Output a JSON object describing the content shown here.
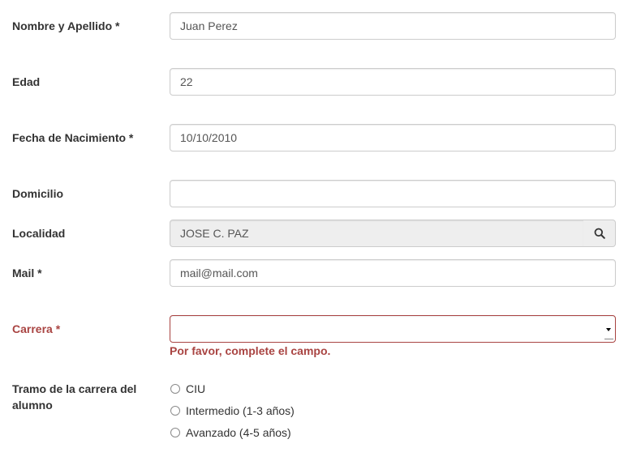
{
  "form": {
    "nombre": {
      "label": "Nombre y Apellido *",
      "value": "Juan Perez"
    },
    "edad": {
      "label": "Edad",
      "value": "22"
    },
    "fecha": {
      "label": "Fecha de Nacimiento *",
      "value": "10/10/2010"
    },
    "domicilio": {
      "label": "Domicilio",
      "value": ""
    },
    "localidad": {
      "label": "Localidad",
      "value": "JOSE C. PAZ",
      "button_icon": "search-icon"
    },
    "mail": {
      "label": "Mail *",
      "value": "mail@mail.com"
    },
    "carrera": {
      "label": "Carrera *",
      "selected": "",
      "error": "Por favor, complete el campo.",
      "error_color": "#a94442"
    },
    "tramo": {
      "label_line1": "Tramo de la carrera del",
      "label_line2": "alumno",
      "options": [
        {
          "label": "CIU",
          "selected": false
        },
        {
          "label": "Intermedio (1-3 años)",
          "selected": false
        },
        {
          "label": "Avanzado (4-5 años)",
          "selected": false
        }
      ]
    }
  }
}
